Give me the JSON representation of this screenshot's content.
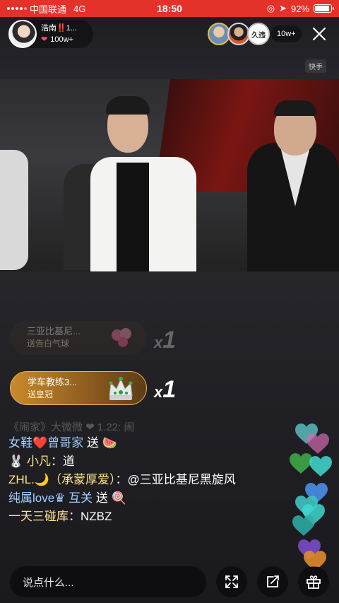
{
  "status_bar": {
    "carrier": "中国联通",
    "network": "4G",
    "time": "18:50",
    "battery": "92%",
    "battery_level": 0.92
  },
  "host": {
    "name": "浩南‼️1...",
    "likes": "100w+"
  },
  "audience": {
    "viewer_3_label": "久违",
    "count": "10w+"
  },
  "platform_tag": "快手",
  "gifts": [
    {
      "sender": "三亚比基尼...",
      "text": "送告白气球",
      "count": "1",
      "prefix": "x"
    },
    {
      "sender": "学车教练3...",
      "text": "送皇冠",
      "count": "1",
      "prefix": "x"
    }
  ],
  "chat": {
    "faded_line": "《闹家》大微微 ❤ 1.22: 闹",
    "line1": {
      "name": "女鞋❤️曾哥家",
      "action": " 送 🍉"
    },
    "line2": {
      "name": "🐰 小凡",
      "text": "：道"
    },
    "line3": {
      "name": "ZHL.🌙（承蒙厚爱）",
      "text": "：@三亚比基尼黑旋风"
    },
    "line4": {
      "name": "纯属love♛  互关",
      "action": " 送 🍭"
    },
    "line5": {
      "name": "一天三碰库",
      "text": "：NZBZ"
    }
  },
  "input_placeholder": "说点什么...",
  "icons": {
    "expand": "expand-icon",
    "share": "share-icon",
    "gift": "gift-icon",
    "close": "close-icon"
  },
  "colors": {
    "status_bar": "#e4322b",
    "gift_active": "#c98a2a",
    "chat_name": "#9fd0ff",
    "chat_name_highlight": "#ffe38a"
  }
}
